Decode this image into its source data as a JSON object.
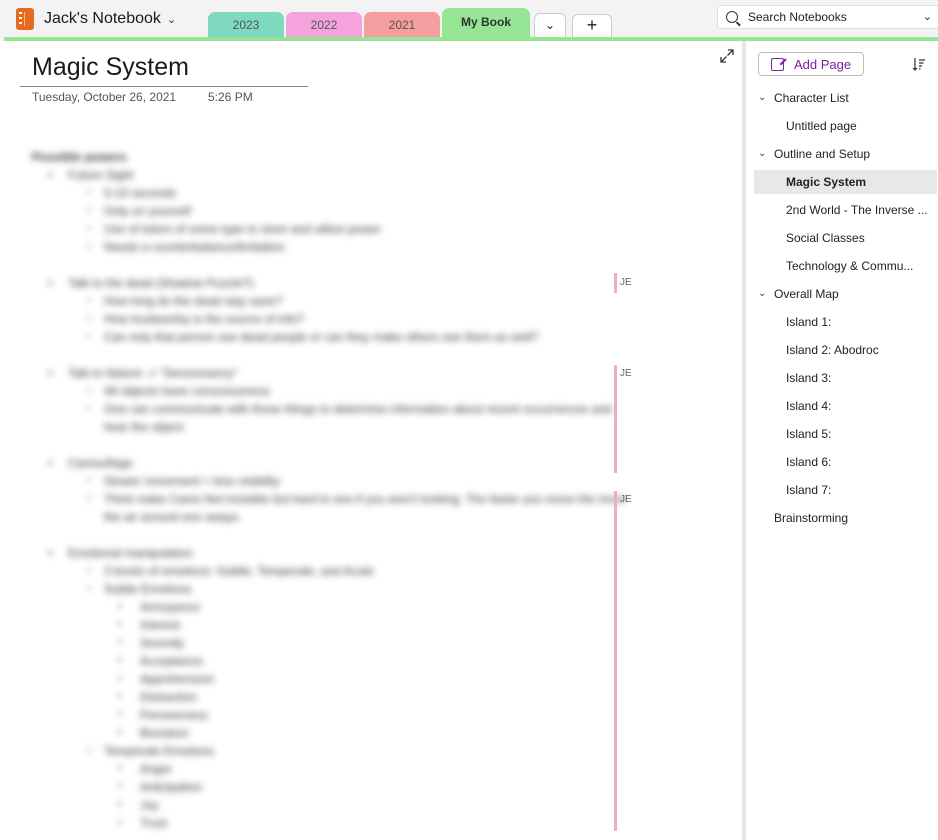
{
  "topbar": {
    "notebook_name": "Jack's Notebook",
    "tabs": [
      {
        "label": "2023",
        "color": "#7ed9bf"
      },
      {
        "label": "2022",
        "color": "#f5a3dc"
      },
      {
        "label": "2021",
        "color": "#f59ea0"
      },
      {
        "label": "My Book",
        "color": "#95e594",
        "active": true
      }
    ],
    "add_tab_label": "+",
    "search_placeholder": "Search Notebooks"
  },
  "page": {
    "title": "Magic System",
    "date": "Tuesday, October 26, 2021",
    "time": "5:26 PM",
    "author_tags": [
      "JE",
      "JE",
      "JE"
    ]
  },
  "sidebar": {
    "add_page_label": "Add Page",
    "pages": [
      {
        "label": "Character List",
        "level": 0,
        "expanded": true
      },
      {
        "label": "Untitled page",
        "level": 1
      },
      {
        "label": "Outline and Setup",
        "level": 0,
        "expanded": true
      },
      {
        "label": "Magic System",
        "level": 1,
        "selected": true
      },
      {
        "label": "2nd World - The Inverse ...",
        "level": 1
      },
      {
        "label": "Social Classes",
        "level": 1
      },
      {
        "label": "Technology & Commu...",
        "level": 1
      },
      {
        "label": "Overall Map",
        "level": 0,
        "expanded": true
      },
      {
        "label": "Island 1:",
        "level": 1
      },
      {
        "label": "Island 2: Abodroc",
        "level": 1
      },
      {
        "label": "Island 3:",
        "level": 1
      },
      {
        "label": "Island 4:",
        "level": 1
      },
      {
        "label": "Island 5:",
        "level": 1
      },
      {
        "label": "Island 6:",
        "level": 1
      },
      {
        "label": "Island 7:",
        "level": 1
      },
      {
        "label": "Brainstorming",
        "level": 0
      }
    ]
  }
}
